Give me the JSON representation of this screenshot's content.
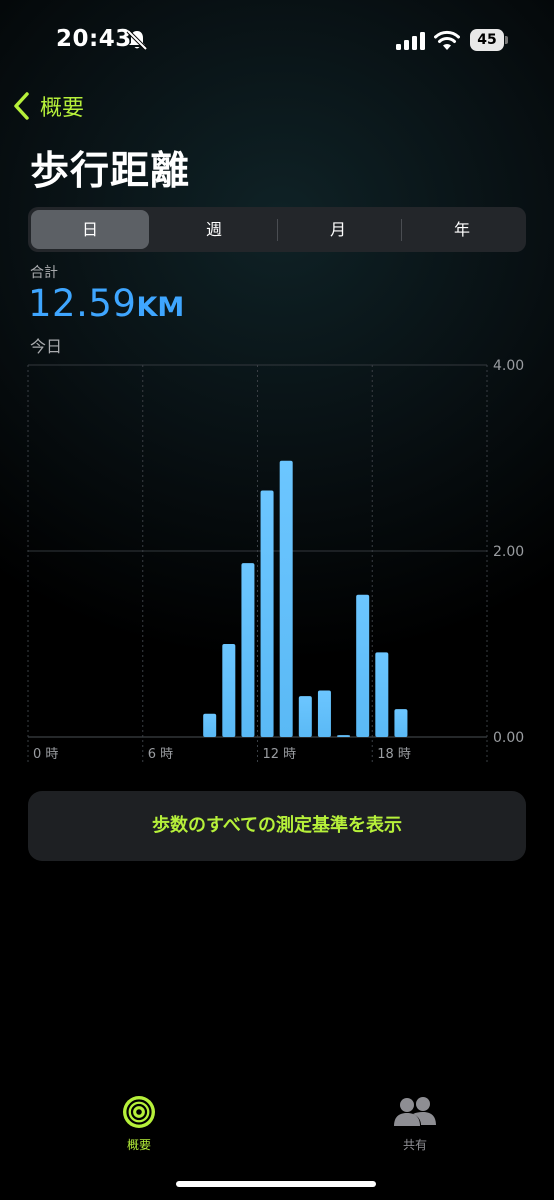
{
  "status_bar": {
    "time": "20:43",
    "battery_level": "45",
    "icons": [
      "bell-slash-icon",
      "cellular-signal-icon",
      "wifi-icon",
      "battery-icon"
    ]
  },
  "nav": {
    "back_label": "概要",
    "back_icon": "chevron-left-icon"
  },
  "page": {
    "title": "歩行距離"
  },
  "segments": {
    "items": [
      "日",
      "週",
      "月",
      "年"
    ],
    "selected": "日"
  },
  "summary": {
    "label": "合計",
    "value": "12.59",
    "unit": "KM",
    "period": "今日"
  },
  "chart_data": {
    "type": "bar",
    "x_tick_labels": [
      "0 時",
      "6 時",
      "12 時",
      "18 時"
    ],
    "y_tick_labels": [
      "4.00",
      "2.00",
      "0.00"
    ],
    "ylim": [
      0,
      4
    ],
    "hours": [
      9,
      10,
      11,
      12,
      13,
      14,
      15,
      16,
      17,
      18,
      19
    ],
    "values": [
      0.25,
      1.0,
      1.87,
      2.65,
      2.97,
      0.44,
      0.5,
      0.02,
      1.53,
      0.91,
      0.3
    ],
    "bar_color": "#5ab9f5",
    "grid": true
  },
  "actions": {
    "all_metrics_label": "歩数のすべての測定基準を表示"
  },
  "tab_bar": {
    "tabs": [
      {
        "label": "概要",
        "icon": "activity-rings-icon",
        "active": true
      },
      {
        "label": "共有",
        "icon": "people-icon",
        "active": false
      }
    ],
    "active_color": "#b6f03a",
    "inactive_color": "#8e8e93"
  }
}
